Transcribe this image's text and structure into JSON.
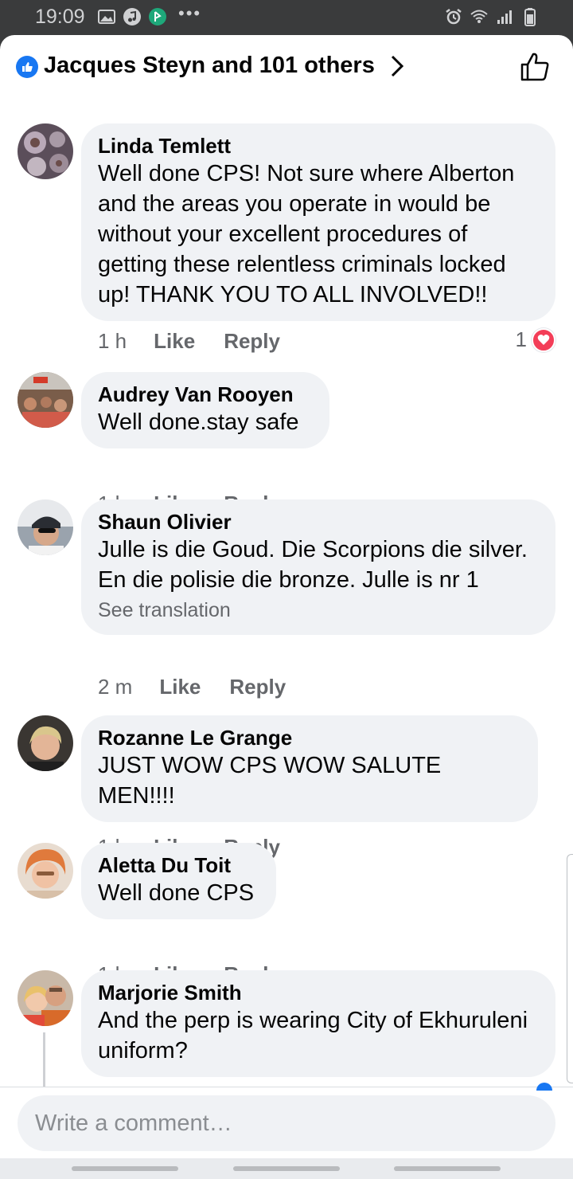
{
  "status_bar": {
    "time": "19:09",
    "left_icons": [
      "gallery-icon",
      "music-icon",
      "app-icon"
    ],
    "right_icons": [
      "alarm-icon",
      "wifi-icon",
      "signal-icon",
      "battery-icon"
    ]
  },
  "header": {
    "title": "Jacques Steyn and 101 others"
  },
  "comments": [
    {
      "author": "Linda Temlett",
      "text": "Well done CPS! Not sure where Alberton and the areas you operate in would be without your excellent procedures of getting these relentless criminals locked up! THANK YOU TO  ALL INVOLVED!!",
      "time": "1 h",
      "like_label": "Like",
      "reply_label": "Reply",
      "reaction_count": "1"
    },
    {
      "author": "Audrey Van Rooyen",
      "text": "Well done.stay safe",
      "time": "1 h",
      "like_label": "Like",
      "reply_label": "Reply"
    },
    {
      "author": "Shaun Olivier",
      "text": "Julle is die Goud.  Die  Scorpions die silver. En die polisie die bronze. Julle is nr 1",
      "translate_label": "See translation",
      "time": "2 m",
      "like_label": "Like",
      "reply_label": "Reply"
    },
    {
      "author": "Rozanne Le Grange",
      "text": "JUST WOW CPS WOW SALUTE MEN!!!!",
      "time": "1 h",
      "like_label": "Like",
      "reply_label": "Reply"
    },
    {
      "author": "Aletta Du Toit",
      "text": "Well done CPS",
      "time": "1 h",
      "like_label": "Like",
      "reply_label": "Reply"
    },
    {
      "author": "Marjorie Smith",
      "text": "And the perp is wearing City of Ekhuruleni uniform?"
    }
  ],
  "composer": {
    "placeholder": "Write a comment…"
  },
  "colors": {
    "accent": "#1877f2",
    "bubble": "#f0f2f5",
    "heart": "#f33e58",
    "muted_text": "#65676b"
  }
}
